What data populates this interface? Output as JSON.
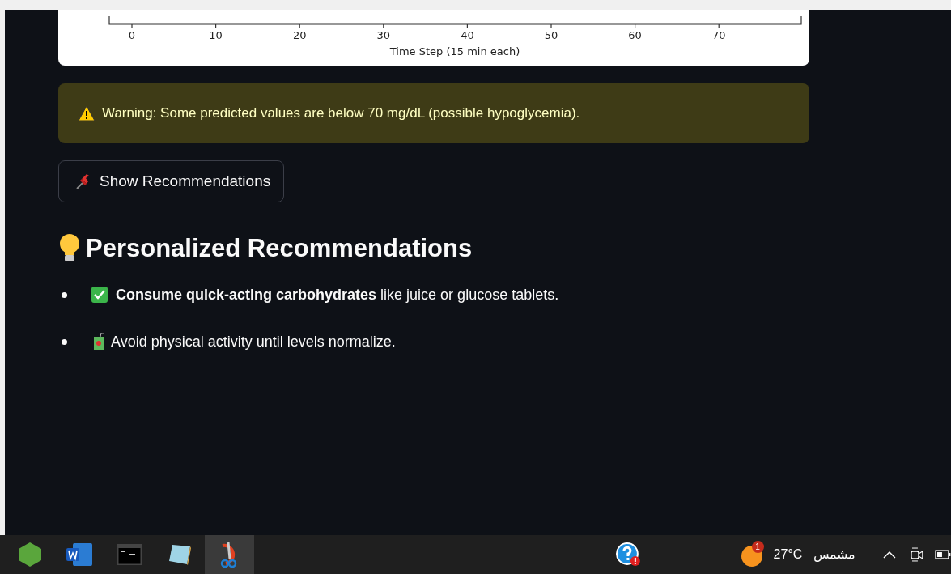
{
  "chart_axis": {
    "tick_labels": [
      "0",
      "10",
      "20",
      "30",
      "40",
      "50",
      "60",
      "70"
    ],
    "xlabel": "Time Step (15 min each)"
  },
  "warning": {
    "text": "Warning: Some predicted values are below 70 mg/dL (possible hypoglycemia)."
  },
  "button": {
    "label": "Show Recommendations"
  },
  "heading": "Personalized Recommendations",
  "recommendations": [
    {
      "kind": "check",
      "text": "**Consume quick-acting carbohydrates** like juice or glucose tablets."
    },
    {
      "kind": "drink",
      "text": "Avoid physical activity until levels normalize."
    }
  ],
  "taskbar": {
    "weather": {
      "temperature": "27°C",
      "condition": "مشمس",
      "badge": "1"
    }
  }
}
